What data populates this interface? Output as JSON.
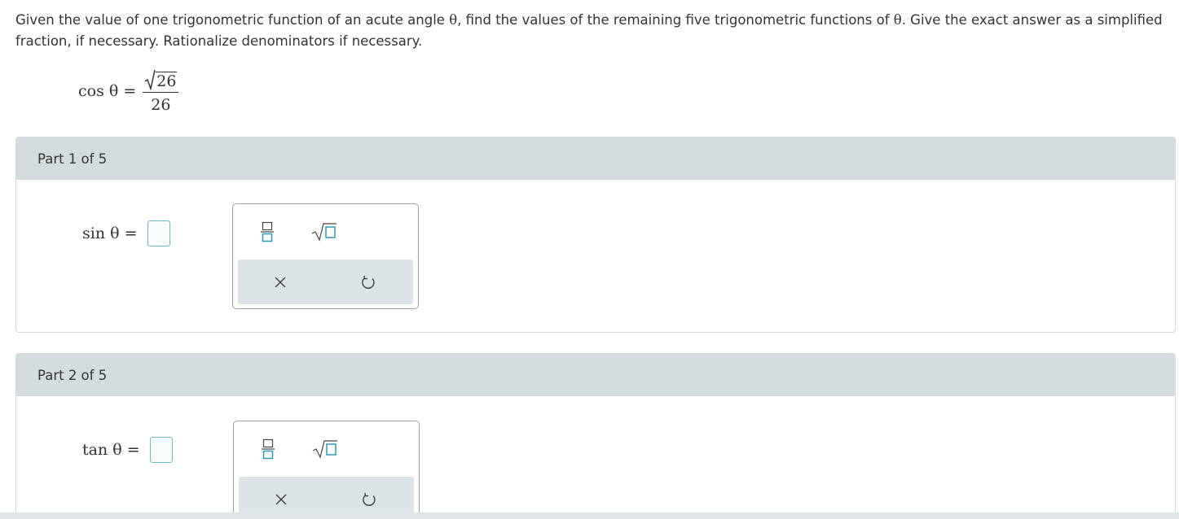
{
  "prompt": {
    "text_before_theta1": "Given the value of one trigonometric function of an acute angle ",
    "theta1": "θ",
    "text_middle": ", find the values of the remaining five trigonometric functions of ",
    "theta2": "θ",
    "text_after": ". Give the exact answer as a simplified fraction, if necessary. Rationalize denominators if necessary."
  },
  "given": {
    "lhs": "cos θ =",
    "numerator_radicand": "26",
    "denominator": "26"
  },
  "parts": [
    {
      "header": "Part 1 of 5",
      "lhs": "sin θ =",
      "tools": {
        "fraction": "fraction-tool",
        "sqrt": "sqrt-tool",
        "clear": "clear-tool",
        "undo": "undo-tool"
      }
    },
    {
      "header": "Part 2 of 5",
      "lhs": "tan θ =",
      "tools": {
        "fraction": "fraction-tool",
        "sqrt": "sqrt-tool",
        "clear": "clear-tool",
        "undo": "undo-tool"
      }
    }
  ],
  "colors": {
    "header_bg": "#d4dce0",
    "answer_border": "#6fb8c9",
    "tool_accent": "#2a9bb3",
    "toolbar_bottom_bg": "#dde4e7"
  }
}
